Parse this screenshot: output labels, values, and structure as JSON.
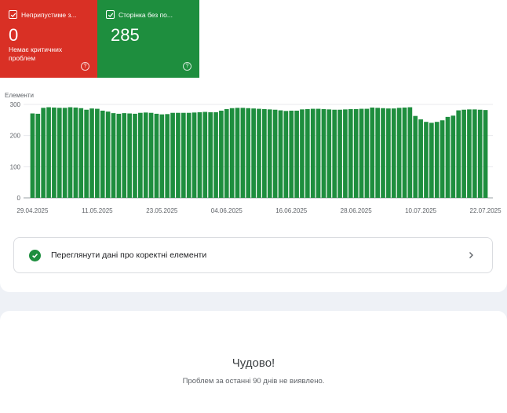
{
  "tiles": {
    "error": {
      "title": "Неприпустиме з...",
      "value": "0",
      "subtitle": "Немає критичних проблем",
      "help": "?"
    },
    "valid": {
      "title": "Сторінка без по...",
      "value": "285",
      "help": "?"
    }
  },
  "chart_data": {
    "type": "bar",
    "title": "",
    "ylabel": "Елементи",
    "xlabel": "",
    "ylim": [
      0,
      300
    ],
    "yticks": [
      0,
      100,
      200,
      300
    ],
    "grid": true,
    "color": "#1e8e3e",
    "xtick_labels": [
      "29.04.2025",
      "11.05.2025",
      "23.05.2025",
      "04.06.2025",
      "16.06.2025",
      "28.06.2025",
      "10.07.2025",
      "22.07.2025"
    ],
    "values": [
      271,
      270,
      289,
      291,
      290,
      289,
      289,
      291,
      290,
      288,
      283,
      287,
      286,
      280,
      277,
      272,
      270,
      272,
      271,
      270,
      273,
      274,
      273,
      270,
      268,
      269,
      273,
      273,
      273,
      273,
      274,
      275,
      276,
      275,
      275,
      280,
      285,
      288,
      289,
      289,
      288,
      287,
      286,
      285,
      284,
      283,
      281,
      279,
      280,
      280,
      284,
      285,
      286,
      286,
      285,
      284,
      283,
      283,
      284,
      285,
      285,
      286,
      286,
      290,
      289,
      288,
      287,
      287,
      289,
      290,
      291,
      263,
      252,
      244,
      241,
      244,
      249,
      260,
      264,
      281,
      283,
      284,
      284,
      283,
      282
    ]
  },
  "link": {
    "label": "Переглянути дані про коректні елементи"
  },
  "bottom": {
    "title": "Чудово!",
    "subtitle": "Проблем за останні 90 днів не виявлено."
  }
}
